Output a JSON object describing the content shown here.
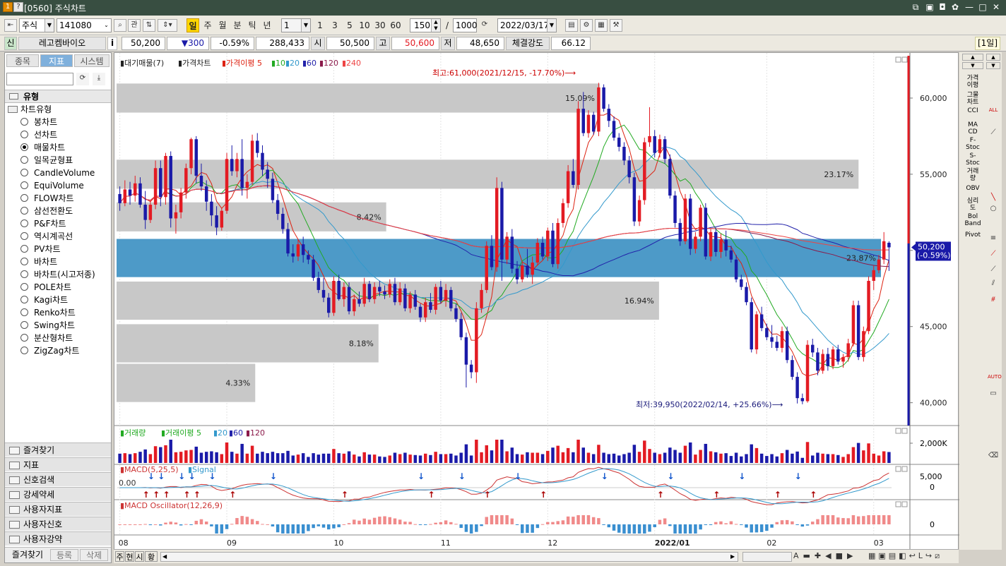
{
  "titlebar": {
    "code": "[0560]",
    "title": "주식차트",
    "icon1": "1",
    "icon2": "?"
  },
  "toolbar": {
    "market": "주식",
    "symbol": "141080",
    "btn_search": "관",
    "periods": [
      "일",
      "주",
      "월",
      "분",
      "틱",
      "년"
    ],
    "interval_value": "1",
    "nums": [
      "1",
      "3",
      "5",
      "10",
      "30",
      "60"
    ],
    "count": "150",
    "sep": "/",
    "total": "1000",
    "date": "2022/03/17"
  },
  "quote": {
    "flag": "신",
    "name": "레고켐바이오",
    "info": "i",
    "price": "50,200",
    "change": "▼300",
    "rate": "-0.59%",
    "volume": "288,433",
    "open_label": "시",
    "open": "50,500",
    "high_label": "고",
    "high": "50,600",
    "low_label": "저",
    "low": "48,650",
    "strength_label": "체결강도",
    "strength": "66.12",
    "period_badge": "[1일]"
  },
  "left": {
    "tabs": [
      "종목",
      "지표",
      "시스템"
    ],
    "section": "유형",
    "tree": "차트유형",
    "types": [
      "봉차트",
      "선차트",
      "매물차트",
      "일목균형표",
      "CandleVolume",
      "EquiVolume",
      "FLOW차트",
      "삼선전환도",
      "P&F차트",
      "역시계곡선",
      "PV차트",
      "바차트",
      "바차트(시고저종)",
      "POLE차트",
      "Kagi차트",
      "Renko차트",
      "Swing차트",
      "분산형차트",
      "ZigZag차트"
    ],
    "selected": 2,
    "accordion": [
      "즐겨찾기",
      "지표",
      "신호검색",
      "강세약세",
      "사용자지표",
      "사용자신호",
      "사용자강약"
    ],
    "footer": [
      "즐겨찾기",
      "등록",
      "삭제"
    ]
  },
  "legend": {
    "items": [
      "대기매물(7)",
      "가격차트",
      "가격이평 5",
      "10",
      "20",
      "60",
      "120",
      "240"
    ]
  },
  "annotations": {
    "high": "최고:61,000(2021/12/15, -17.70%)",
    "low": "최저:39,950(2022/02/14, +25.66%)",
    "pcts": [
      "15.09%",
      "23.17%",
      "8.42%",
      "23.87%",
      "16.94%",
      "8.18%",
      "4.33%"
    ]
  },
  "price_axis": [
    "60,000",
    "55,000",
    "50,000",
    "45,000",
    "40,000"
  ],
  "current": {
    "price": "50,200",
    "rate": "(-0.59%)"
  },
  "volume_panel": {
    "legend": [
      "거래량",
      "거래이평 5",
      "20",
      "60",
      "120"
    ],
    "axis": "2,000K"
  },
  "macd_panel": {
    "legend": [
      "MACD(5,25,5)",
      "Signal"
    ],
    "zero": "0.00",
    "axis": [
      "5,000",
      "0"
    ]
  },
  "osc_panel": {
    "legend": "MACD Oscillator(12,26,9)",
    "axis": "0"
  },
  "x_axis": [
    "08",
    "09",
    "10",
    "11",
    "12",
    "2022/01",
    "02",
    "03"
  ],
  "bottom": {
    "tabs": [
      "주",
      "현",
      "시",
      "황"
    ]
  },
  "rightbar": [
    "가격\n이평",
    "그물\n차트",
    "CCI",
    "MA\nCD",
    "F-\nStoc",
    "S-\nStoc",
    "거래\n량",
    "OBV",
    "심리\n도",
    "Bol\nBand",
    "Pivot"
  ],
  "colors": {
    "up": "#e31b23",
    "down": "#1a1aa8",
    "volbox": "#c8c8c8",
    "highlight": "#4d9ac8"
  },
  "chart_data": {
    "type": "candlestick",
    "price_range": [
      38500,
      62500
    ],
    "candles": [
      [
        53700,
        54200,
        52600,
        53100
      ],
      [
        53100,
        54600,
        52900,
        54000
      ],
      [
        54000,
        54500,
        53000,
        53600
      ],
      [
        53600,
        54900,
        53200,
        54400
      ],
      [
        54400,
        54800,
        52800,
        53000
      ],
      [
        53000,
        53900,
        51400,
        52000
      ],
      [
        52000,
        53300,
        51800,
        53000
      ],
      [
        53000,
        55900,
        52700,
        55400
      ],
      [
        55400,
        55900,
        52900,
        53500
      ],
      [
        53500,
        56400,
        53000,
        56200
      ],
      [
        56200,
        56500,
        51500,
        52100
      ],
      [
        52100,
        53000,
        51100,
        52500
      ],
      [
        52500,
        54100,
        52100,
        53800
      ],
      [
        53800,
        55700,
        53400,
        55400
      ],
      [
        55400,
        57400,
        55000,
        57300
      ],
      [
        57300,
        57500,
        54400,
        54900
      ],
      [
        54900,
        55700,
        53900,
        54200
      ],
      [
        54200,
        54600,
        52600,
        53200
      ],
      [
        53200,
        53700,
        51600,
        52300
      ],
      [
        52300,
        52900,
        51000,
        51500
      ],
      [
        51500,
        52800,
        51300,
        52600
      ],
      [
        52600,
        56400,
        52400,
        56000
      ],
      [
        56000,
        56900,
        54900,
        55200
      ],
      [
        55200,
        56400,
        54800,
        56000
      ],
      [
        56000,
        57300,
        53600,
        54100
      ],
      [
        54100,
        55000,
        53400,
        54500
      ],
      [
        54500,
        57600,
        54300,
        57200
      ],
      [
        57200,
        57700,
        56100,
        56400
      ],
      [
        56400,
        56900,
        54900,
        55300
      ],
      [
        55300,
        55800,
        54100,
        54700
      ],
      [
        54700,
        55100,
        53100,
        53300
      ],
      [
        53300,
        53700,
        52000,
        52400
      ],
      [
        52400,
        52800,
        51100,
        51400
      ],
      [
        51400,
        51800,
        49600,
        49800
      ],
      [
        49800,
        50400,
        49200,
        49600
      ],
      [
        49600,
        50700,
        49300,
        50400
      ],
      [
        50400,
        50900,
        49200,
        49700
      ],
      [
        49700,
        50000,
        49100,
        49400
      ],
      [
        49400,
        49700,
        48000,
        48200
      ],
      [
        48200,
        48600,
        47200,
        47400
      ],
      [
        47400,
        48200,
        46600,
        46900
      ],
      [
        46900,
        47200,
        45600,
        45900
      ],
      [
        45900,
        48300,
        45700,
        48000
      ],
      [
        48000,
        48400,
        46700,
        46800
      ],
      [
        46800,
        47900,
        46300,
        47600
      ],
      [
        47600,
        47900,
        45800,
        46000
      ],
      [
        46000,
        47100,
        45700,
        46800
      ],
      [
        46800,
        47300,
        46300,
        46500
      ],
      [
        46500,
        48200,
        46300,
        47800
      ],
      [
        47800,
        48000,
        46600,
        46800
      ],
      [
        46800,
        47900,
        46500,
        47600
      ],
      [
        47600,
        48000,
        47000,
        47300
      ],
      [
        47300,
        47700,
        46800,
        47100
      ],
      [
        47100,
        48100,
        46900,
        47800
      ],
      [
        47800,
        48200,
        46400,
        46600
      ],
      [
        46600,
        47900,
        46400,
        47500
      ],
      [
        47500,
        47800,
        46000,
        46200
      ],
      [
        46200,
        47300,
        45900,
        47100
      ],
      [
        47100,
        47400,
        46100,
        46300
      ],
      [
        46300,
        46500,
        45300,
        45600
      ],
      [
        45600,
        46900,
        45300,
        46600
      ],
      [
        46600,
        47200,
        45900,
        46100
      ],
      [
        46100,
        47800,
        45800,
        47600
      ],
      [
        47600,
        48000,
        46500,
        46700
      ],
      [
        46700,
        47800,
        46300,
        47400
      ],
      [
        47400,
        47600,
        46000,
        46200
      ],
      [
        46200,
        46500,
        45300,
        45500
      ],
      [
        45500,
        45900,
        44100,
        44300
      ],
      [
        44300,
        44600,
        41000,
        42500
      ],
      [
        42500,
        42800,
        41600,
        42000
      ],
      [
        42000,
        46600,
        41300,
        46200
      ],
      [
        46200,
        47800,
        45900,
        47400
      ],
      [
        47400,
        50600,
        47200,
        50300
      ],
      [
        50300,
        51000,
        48700,
        48900
      ],
      [
        48900,
        54800,
        48600,
        54100
      ],
      [
        54100,
        54500,
        48000,
        49400
      ],
      [
        49400,
        51200,
        49100,
        50900
      ],
      [
        50900,
        51400,
        48500,
        48800
      ],
      [
        48800,
        49300,
        47800,
        48100
      ],
      [
        48100,
        49300,
        47900,
        49000
      ],
      [
        49000,
        50100,
        48200,
        48400
      ],
      [
        48400,
        49600,
        47800,
        49200
      ],
      [
        49200,
        50800,
        49000,
        50500
      ],
      [
        50500,
        50900,
        49400,
        49600
      ],
      [
        49600,
        51500,
        49300,
        51300
      ],
      [
        51300,
        51800,
        48900,
        49100
      ],
      [
        49100,
        52100,
        48800,
        51800
      ],
      [
        51800,
        53400,
        51500,
        53100
      ],
      [
        53100,
        55600,
        52800,
        55200
      ],
      [
        55200,
        56000,
        54100,
        54300
      ],
      [
        54300,
        59800,
        54000,
        59300
      ],
      [
        59300,
        60400,
        57500,
        57700
      ],
      [
        57700,
        59200,
        57400,
        58900
      ],
      [
        58900,
        59100,
        57600,
        57800
      ],
      [
        57800,
        61000,
        57500,
        60700
      ],
      [
        60700,
        60900,
        59100,
        59300
      ],
      [
        59300,
        59600,
        58100,
        58500
      ],
      [
        58500,
        58800,
        57200,
        57400
      ],
      [
        57400,
        57700,
        56500,
        56800
      ],
      [
        56800,
        57100,
        55600,
        55900
      ],
      [
        55900,
        56200,
        54400,
        54800
      ],
      [
        54800,
        55100,
        51600,
        51900
      ],
      [
        51900,
        53600,
        51600,
        53300
      ],
      [
        53300,
        57400,
        53000,
        57100
      ],
      [
        57100,
        59400,
        56800,
        57500
      ],
      [
        57500,
        57900,
        56100,
        56400
      ],
      [
        56400,
        57600,
        56100,
        57300
      ],
      [
        57300,
        57500,
        55700,
        56000
      ],
      [
        56000,
        56300,
        53400,
        53600
      ],
      [
        53600,
        53900,
        51500,
        51800
      ],
      [
        51800,
        52100,
        50300,
        50600
      ],
      [
        50600,
        53700,
        50400,
        53400
      ],
      [
        53400,
        53700,
        49700,
        50100
      ],
      [
        50100,
        51200,
        49800,
        50900
      ],
      [
        50900,
        53000,
        50600,
        52800
      ],
      [
        52800,
        53100,
        49400,
        49600
      ],
      [
        49600,
        51400,
        49300,
        51200
      ],
      [
        51200,
        51500,
        49600,
        49900
      ],
      [
        49900,
        51100,
        49500,
        50700
      ],
      [
        50700,
        51300,
        49600,
        50000
      ],
      [
        50000,
        50300,
        49200,
        49400
      ],
      [
        49400,
        49700,
        47900,
        48100
      ],
      [
        48100,
        48400,
        47400,
        47600
      ],
      [
        47600,
        47900,
        46400,
        46600
      ],
      [
        46600,
        46900,
        43300,
        43500
      ],
      [
        43500,
        46000,
        43200,
        45800
      ],
      [
        45800,
        46300,
        44700,
        44900
      ],
      [
        44900,
        45200,
        44100,
        44300
      ],
      [
        44300,
        45100,
        43600,
        44000
      ],
      [
        44000,
        44400,
        43400,
        43600
      ],
      [
        43600,
        45000,
        43300,
        44700
      ],
      [
        44700,
        45000,
        42600,
        42800
      ],
      [
        42800,
        43100,
        41500,
        41700
      ],
      [
        41700,
        42000,
        39950,
        40300
      ],
      [
        40300,
        40600,
        39900,
        40100
      ],
      [
        40100,
        44100,
        40000,
        43800
      ],
      [
        43800,
        44200,
        43000,
        43300
      ],
      [
        43300,
        43600,
        41800,
        42100
      ],
      [
        42100,
        43500,
        41900,
        43200
      ],
      [
        43200,
        43600,
        42100,
        42400
      ],
      [
        42400,
        43700,
        42200,
        43500
      ],
      [
        43500,
        43800,
        42500,
        42700
      ],
      [
        42700,
        43200,
        42300,
        43000
      ],
      [
        43000,
        44200,
        42700,
        43900
      ],
      [
        43900,
        46700,
        43700,
        46400
      ],
      [
        46400,
        46700,
        42800,
        43000
      ],
      [
        43000,
        45000,
        42700,
        44700
      ],
      [
        44700,
        48300,
        44500,
        48000
      ],
      [
        48000,
        49000,
        47400,
        48700
      ],
      [
        48700,
        49700,
        48500,
        49400
      ],
      [
        49400,
        51200,
        49100,
        50600
      ],
      [
        50500,
        50600,
        48650,
        50200
      ]
    ],
    "volume_max_k": 2000,
    "volume_sample": [
      180,
      150,
      120,
      200,
      300,
      250,
      180,
      150,
      120,
      100,
      90,
      80,
      350,
      700,
      450,
      1500,
      400,
      200,
      150,
      300,
      200,
      1400,
      600,
      300,
      200,
      150,
      120,
      100,
      80,
      60
    ],
    "highlight_band": [
      48200,
      50800
    ],
    "volume_profile_pct": [
      15.09,
      23.17,
      8.42,
      23.87,
      16.94,
      8.18,
      4.33
    ]
  }
}
